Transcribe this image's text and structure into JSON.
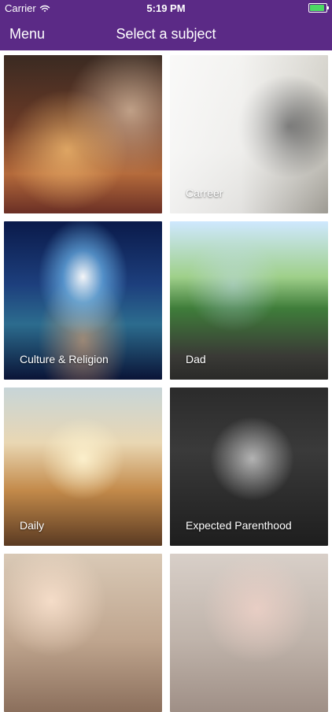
{
  "status_bar": {
    "carrier": "Carrier",
    "time": "5:19 PM"
  },
  "nav": {
    "menu_label": "Menu",
    "title": "Select a subject"
  },
  "tiles": [
    {
      "label": ""
    },
    {
      "label": "Carreer"
    },
    {
      "label": "Culture & Religion"
    },
    {
      "label": "Dad"
    },
    {
      "label": "Daily"
    },
    {
      "label": "Expected Parenthood"
    },
    {
      "label": ""
    },
    {
      "label": ""
    }
  ],
  "colors": {
    "nav_bg": "#5b2a86",
    "battery": "#4cd964"
  }
}
